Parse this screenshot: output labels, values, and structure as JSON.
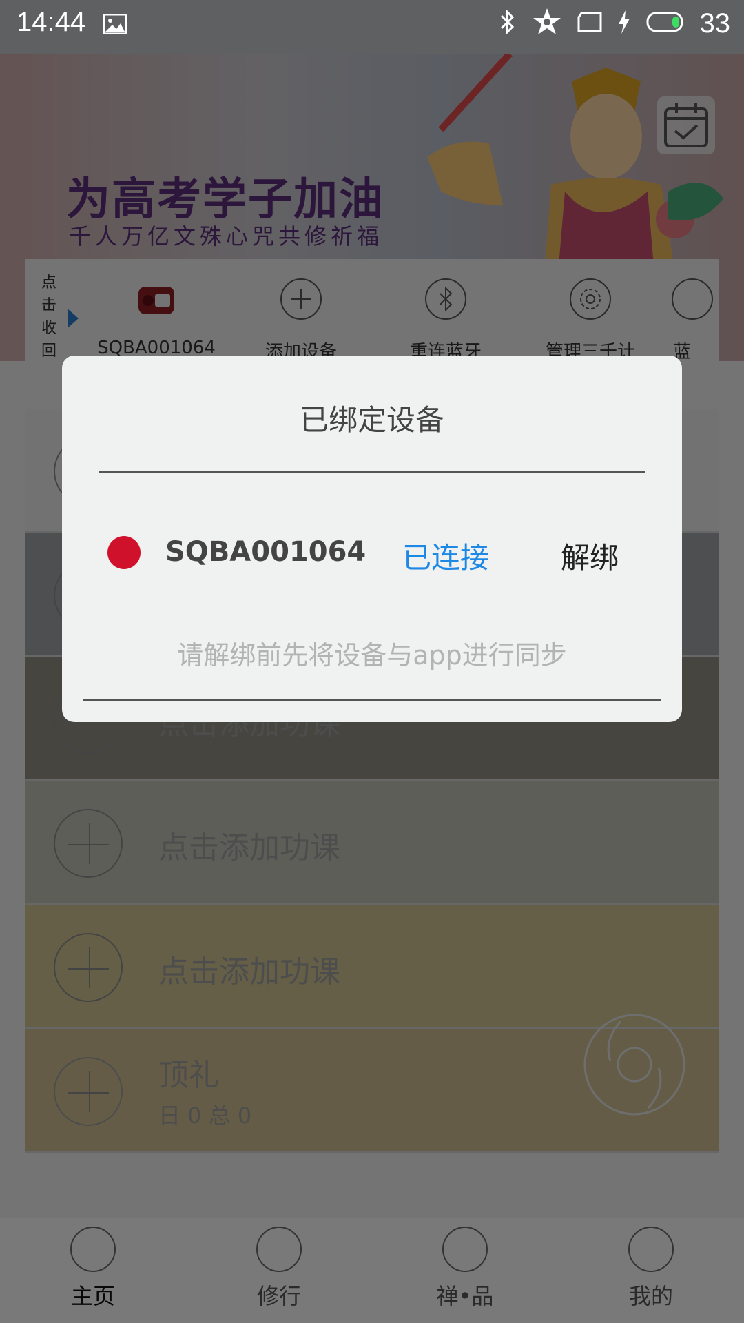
{
  "status_bar": {
    "time": "14:44",
    "battery": "33"
  },
  "banner": {
    "title": "为高考学子加油",
    "subtitle": "千人万亿文殊心咒共修祈福"
  },
  "device_strip": {
    "collapse_label": "点击收回",
    "items": [
      {
        "label": "SQBA001064",
        "icon": "device-icon"
      },
      {
        "label": "添加设备",
        "icon": "plus-circle-icon"
      },
      {
        "label": "重连蓝牙",
        "icon": "bluetooth-icon"
      },
      {
        "label": "管理三千计",
        "icon": "gear-icon"
      },
      {
        "label": "蓝",
        "icon": "partial-icon"
      }
    ]
  },
  "list": {
    "rows": [
      {
        "text": ""
      },
      {
        "text": ""
      },
      {
        "text": "点击添加功课"
      },
      {
        "text": "点击添加功课"
      },
      {
        "text": "点击添加功课"
      },
      {
        "text": "顶礼",
        "sub": "日 0 总 0"
      }
    ]
  },
  "dialog": {
    "title": "已绑定设备",
    "device_name": "SQBA001064",
    "status": "已连接",
    "unbind": "解绑",
    "hint": "请解绑前先将设备与app进行同步",
    "status_color": "#1e88e5",
    "dot_color": "#d0112b"
  },
  "bottom_nav": [
    {
      "label": "主页",
      "icon": "temple-icon"
    },
    {
      "label": "修行",
      "icon": "lotus-icon"
    },
    {
      "label": "禅•品",
      "icon": "vase-icon"
    },
    {
      "label": "我的",
      "icon": "meditation-icon"
    }
  ]
}
